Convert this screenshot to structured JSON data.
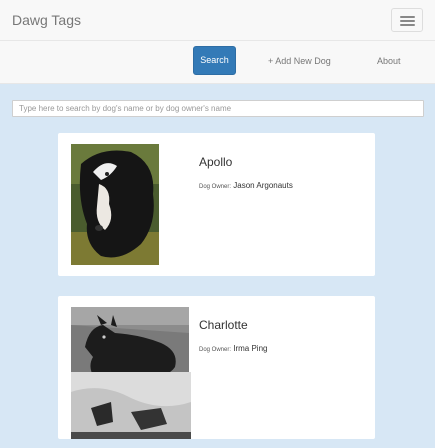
{
  "app": {
    "title": "Dawg Tags"
  },
  "nav": {
    "search_label": "Search",
    "add_label": "+ Add New Dog",
    "about_label": "About"
  },
  "search": {
    "placeholder": "Type here to search by dog's name or by dog owner's name"
  },
  "dogs": [
    {
      "name": "Apollo",
      "owner_label": "Dog Owner:",
      "owner": "Jason Argonauts"
    },
    {
      "name": "Charlotte",
      "owner_label": "Dog Owner:",
      "owner": "Irma Ping"
    }
  ],
  "icons": [
    "menu-icon"
  ],
  "colors": {
    "primary": "#337ab7",
    "background": "#d7e7f5"
  }
}
